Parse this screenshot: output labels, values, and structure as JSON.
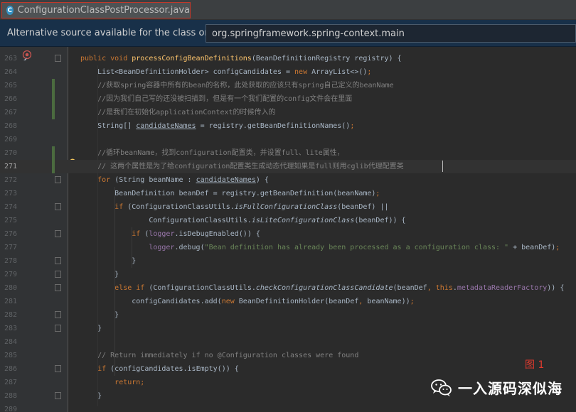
{
  "tab": {
    "label": "ConfigurationClassPostProcessor.java",
    "icon": "java-class-icon",
    "close": "×"
  },
  "infobar": {
    "message": "Alternative source available for the class org....",
    "selected": "org.springframework.spring-context.main"
  },
  "figure_label": "图 1",
  "watermark": "一入源码深似海",
  "colors": {
    "background": "#2b2b2b",
    "keyword": "#cc7832",
    "comment": "#808080",
    "string": "#6a8759",
    "field": "#9876aa",
    "accent_red": "#e03a2e"
  },
  "code_lines": [
    {
      "n": "263",
      "text": "public void processConfigBeanDefinitions(BeanDefinitionRegistry registry) {"
    },
    {
      "n": "264",
      "text": "List<BeanDefinitionHolder> configCandidates = new ArrayList<>();"
    },
    {
      "n": "265",
      "text": "//获取spring容器中所有的bean的名称，此处获取的应该只有spring自己定义的beanName"
    },
    {
      "n": "266",
      "text": "//因为我们自己写的还没被扫描到，但是有一个我们配置的config文件会在里面"
    },
    {
      "n": "267",
      "text": "//是我们在初始化applicationContext的时候传入的"
    },
    {
      "n": "268",
      "text": "String[] candidateNames = registry.getBeanDefinitionNames();"
    },
    {
      "n": "269",
      "text": ""
    },
    {
      "n": "270",
      "text": "//循环beanName，找到configuration配置类，并设置full、lite属性，"
    },
    {
      "n": "271",
      "text": "// 这两个属性是为了给configuration配置类生成动态代理如果是full则用cglib代理配置类"
    },
    {
      "n": "272",
      "text": "for (String beanName : candidateNames) {"
    },
    {
      "n": "273",
      "text": "BeanDefinition beanDef = registry.getBeanDefinition(beanName);"
    },
    {
      "n": "274",
      "text": "if (ConfigurationClassUtils.isFullConfigurationClass(beanDef) ||"
    },
    {
      "n": "275",
      "text": "ConfigurationClassUtils.isLiteConfigurationClass(beanDef)) {"
    },
    {
      "n": "276",
      "text": "if (logger.isDebugEnabled()) {"
    },
    {
      "n": "277",
      "text": "logger.debug(\"Bean definition has already been processed as a configuration class: \" + beanDef);"
    },
    {
      "n": "278",
      "text": "}"
    },
    {
      "n": "279",
      "text": "}"
    },
    {
      "n": "280",
      "text": "else if (ConfigurationClassUtils.checkConfigurationClassCandidate(beanDef, this.metadataReaderFactory)) {"
    },
    {
      "n": "281",
      "text": "configCandidates.add(new BeanDefinitionHolder(beanDef, beanName));"
    },
    {
      "n": "282",
      "text": "}"
    },
    {
      "n": "283",
      "text": "}"
    },
    {
      "n": "284",
      "text": ""
    },
    {
      "n": "285",
      "text": "// Return immediately if no @Configuration classes were found"
    },
    {
      "n": "286",
      "text": "if (configCandidates.isEmpty()) {"
    },
    {
      "n": "287",
      "text": "return;"
    },
    {
      "n": "288",
      "text": "}"
    },
    {
      "n": "289",
      "text": ""
    }
  ]
}
